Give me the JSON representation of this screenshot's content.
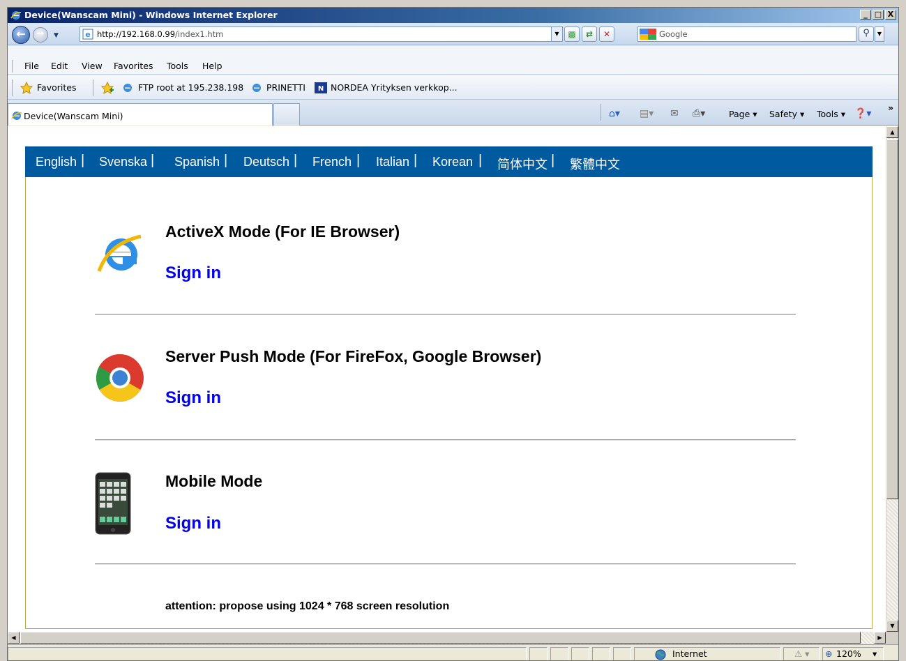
{
  "window": {
    "title": "Device(Wanscam Mini) - Windows Internet Explorer",
    "minimize": "_",
    "maximize": "□",
    "close": "X"
  },
  "address": {
    "url_host": "http://192.168.0.99",
    "url_path": "/index1.htm",
    "search_placeholder": "Google"
  },
  "menu": {
    "items": [
      "File",
      "Edit",
      "View",
      "Favorites",
      "Tools",
      "Help"
    ]
  },
  "favorites": {
    "button": "Favorites",
    "links": [
      "FTP root at 195.238.198",
      "PRINETTI",
      "NORDEA Yrityksen verkkop..."
    ]
  },
  "tab": {
    "title": "Device(Wanscam Mini)"
  },
  "commandbar": {
    "page": "Page",
    "safety": "Safety",
    "tools": "Tools",
    "overflow": "»"
  },
  "page": {
    "languages": [
      "English",
      "Svenska",
      "Spanish",
      "Deutsch",
      "French",
      "Italian",
      "Korean",
      "简体中文",
      "繁體中文"
    ],
    "sections": [
      {
        "title": "ActiveX Mode (For IE Browser)",
        "link": "Sign in",
        "icon": "ie-icon"
      },
      {
        "title": "Server Push Mode (For FireFox, Google Browser)",
        "link": "Sign in",
        "icon": "chrome-icon"
      },
      {
        "title": "Mobile Mode",
        "link": "Sign in",
        "icon": "iphone-icon"
      }
    ],
    "attention": "attention: propose using 1024 * 768 screen resolution"
  },
  "status": {
    "zone": "Internet",
    "zoom": "120%"
  },
  "colors": {
    "lang_bar": "#005aa0",
    "link": "#0000ee",
    "frame_border": "#c8a64a"
  }
}
